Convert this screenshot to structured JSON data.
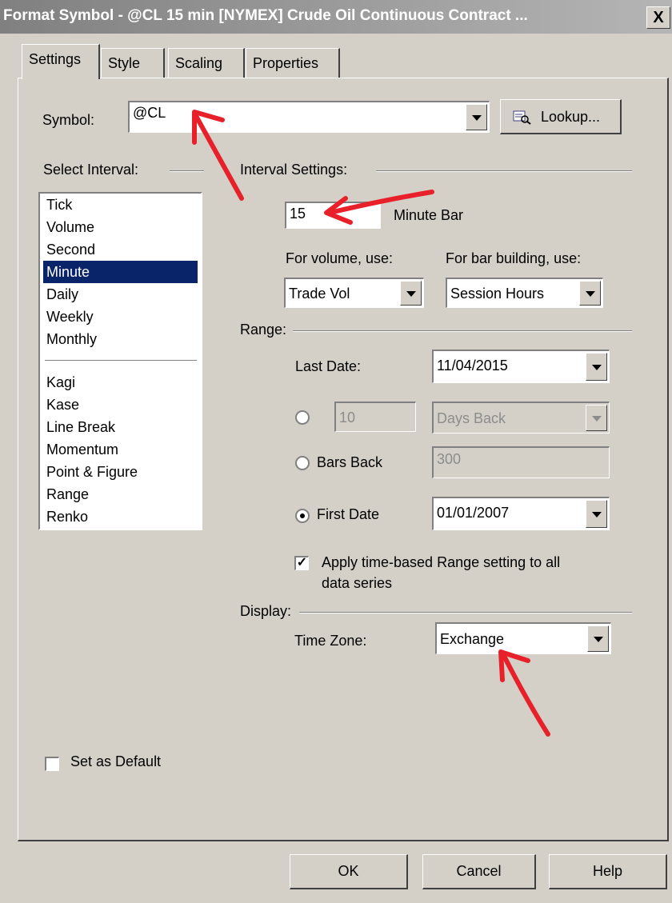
{
  "window": {
    "title": "Format Symbol - @CL 15 min [NYMEX] Crude Oil Continuous Contract ...",
    "close_label": "X"
  },
  "tabs": [
    "Settings",
    "Style",
    "Scaling",
    "Properties"
  ],
  "symbol": {
    "label": "Symbol:",
    "value": "@CL",
    "lookup_label": "Lookup..."
  },
  "select_interval": {
    "label": "Select Interval:",
    "group1": [
      "Tick",
      "Volume",
      "Second",
      "Minute",
      "Daily",
      "Weekly",
      "Monthly"
    ],
    "group2": [
      "Kagi",
      "Kase",
      "Line Break",
      "Momentum",
      "Point & Figure",
      "Range",
      "Renko"
    ],
    "selected": "Minute"
  },
  "interval_settings": {
    "label": "Interval Settings:",
    "value": "15",
    "unit": "Minute Bar",
    "volume_label": "For volume, use:",
    "volume_value": "Trade Vol",
    "bar_building_label": "For bar building, use:",
    "bar_building_value": "Session Hours"
  },
  "range": {
    "label": "Range:",
    "last_date_label": "Last Date:",
    "last_date_value": "11/04/2015",
    "back_value": "10",
    "back_unit": "Days Back",
    "bars_back_label": "Bars Back",
    "bars_back_value": "300",
    "first_date_label": "First Date",
    "first_date_value": "01/01/2007",
    "apply_label_line1": "Apply time-based Range setting to all",
    "apply_label_line2": "data series"
  },
  "display": {
    "label": "Display:",
    "timezone_label": "Time Zone:",
    "timezone_value": "Exchange"
  },
  "set_default_label": "Set as Default",
  "buttons": {
    "ok": "OK",
    "cancel": "Cancel",
    "help": "Help"
  },
  "colors": {
    "selection": "#0a246a",
    "arrow": "#e8202a",
    "face": "#d4d0c8"
  }
}
